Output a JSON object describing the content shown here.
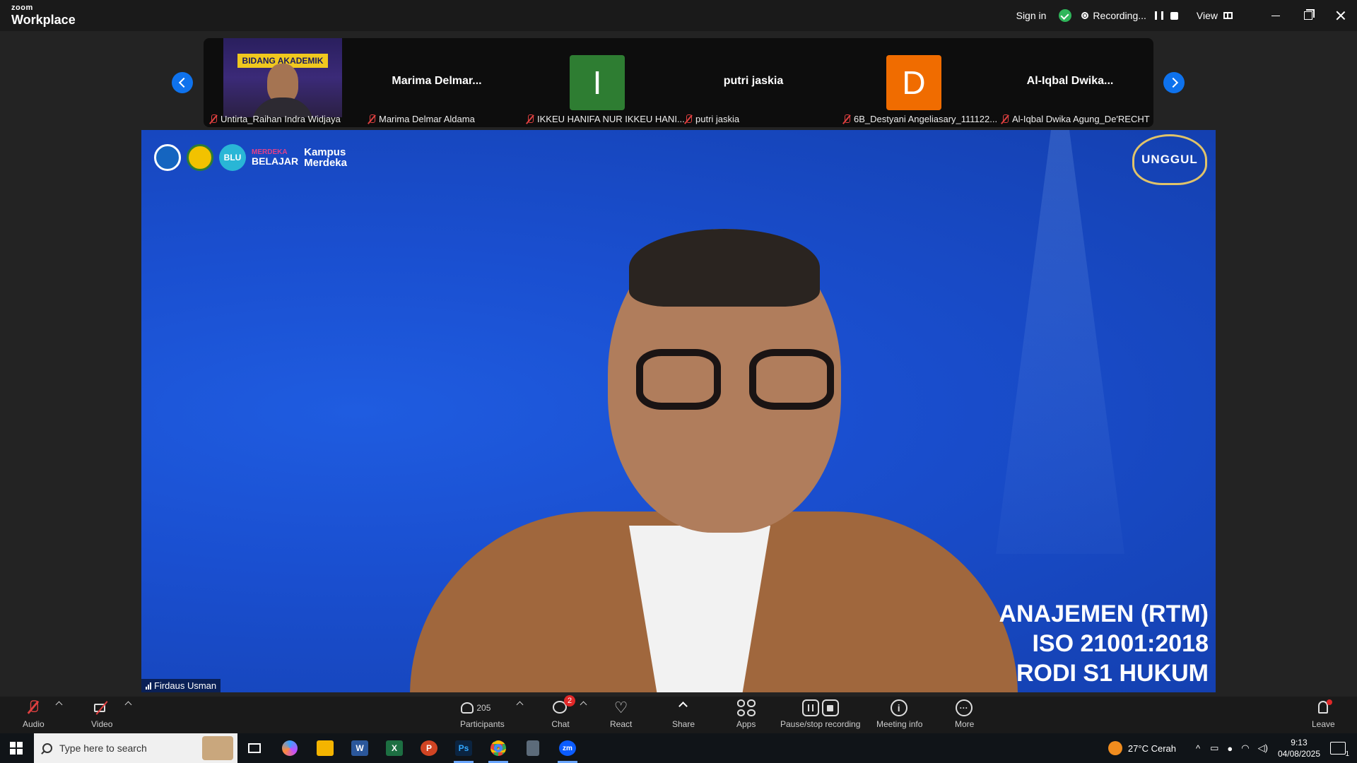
{
  "app": {
    "logo_line1": "zoom",
    "logo_line2": "Workplace"
  },
  "titlebar": {
    "signin_label": "Sign in",
    "recording_label": "Recording...",
    "view_label": "View"
  },
  "thumbnails": [
    {
      "name": "Untirta_Raihan Indra Widjaya",
      "type": "video",
      "banner": "BIDANG AKADEMIK"
    },
    {
      "name": "Marima Delmar Aldama",
      "type": "name",
      "display": "Marima  Delmar..."
    },
    {
      "name": "IKKEU HANIFA NUR IKKEU HANI...",
      "type": "avatar",
      "letter": "I",
      "color": "#2e7d32"
    },
    {
      "name": "putri jaskia",
      "type": "name",
      "display": "putri jaskia"
    },
    {
      "name": "6B_Destyani Angeliasary_111122...",
      "type": "avatar",
      "letter": "D",
      "color": "#f06c00"
    },
    {
      "name": "Al-Iqbal Dwika Agung_De'RECHT",
      "type": "name",
      "display": "Al-Iqbal  Dwika..."
    }
  ],
  "main_video": {
    "speaker_name": "Firdaus Usman",
    "logos": {
      "merdeka_top": "MERDEKA",
      "merdeka_bottom": "BELAJAR",
      "kampus": "Kampus Merdeka",
      "blu": "BLU"
    },
    "emblem_text": "UNGGUL",
    "slide_lines": [
      "ANAJEMEN (RTM)",
      "ISO 21001:2018",
      "RODI S1 HUKUM"
    ]
  },
  "toolbar": {
    "audio": "Audio",
    "video": "Video",
    "participants": "Participants",
    "participants_count": "205",
    "chat": "Chat",
    "chat_badge": "2",
    "react": "React",
    "share": "Share",
    "apps": "Apps",
    "pause_recording": "Pause/stop recording",
    "meeting_info": "Meeting info",
    "more": "More",
    "leave": "Leave"
  },
  "taskbar": {
    "search_placeholder": "Type here to search",
    "weather": "27°C  Cerah",
    "time": "9:13",
    "date": "04/08/2025",
    "notification_count": "1",
    "apps": [
      "task-view",
      "copilot",
      "file-explorer",
      "word",
      "excel",
      "powerpoint",
      "photoshop",
      "chrome",
      "calculator",
      "zoom"
    ]
  }
}
